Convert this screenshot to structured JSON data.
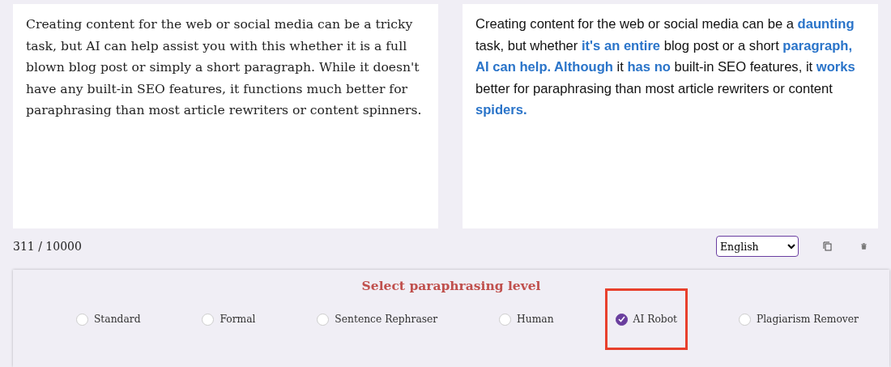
{
  "input_text": "Creating content for the web or social media can be a tricky task, but AI can help assist you with this whether it is a full blown blog post or simply a short paragraph. While it doesn't have any built-in SEO features, it functions much better for paraphrasing than most article rewriters or content spinners.",
  "output_text": "Creating content for the web or social media can be a **daunting** task, but whether **it's an entire** blog post or a short **paragraph, AI can help. Although** it **has no** built-in SEO features, it **works** better for paraphrasing than most article rewriters or content **spiders.**",
  "char_count": "311 / 10000",
  "language": "English",
  "level_title": "Select paraphrasing level",
  "levels": [
    {
      "label": "Standard",
      "selected": false,
      "highlighted": false
    },
    {
      "label": "Formal",
      "selected": false,
      "highlighted": false
    },
    {
      "label": "Sentence Rephraser",
      "selected": false,
      "highlighted": false
    },
    {
      "label": "Human",
      "selected": false,
      "highlighted": false
    },
    {
      "label": "AI Robot",
      "selected": true,
      "highlighted": true
    },
    {
      "label": "Plagiarism Remover",
      "selected": false,
      "highlighted": false
    }
  ]
}
